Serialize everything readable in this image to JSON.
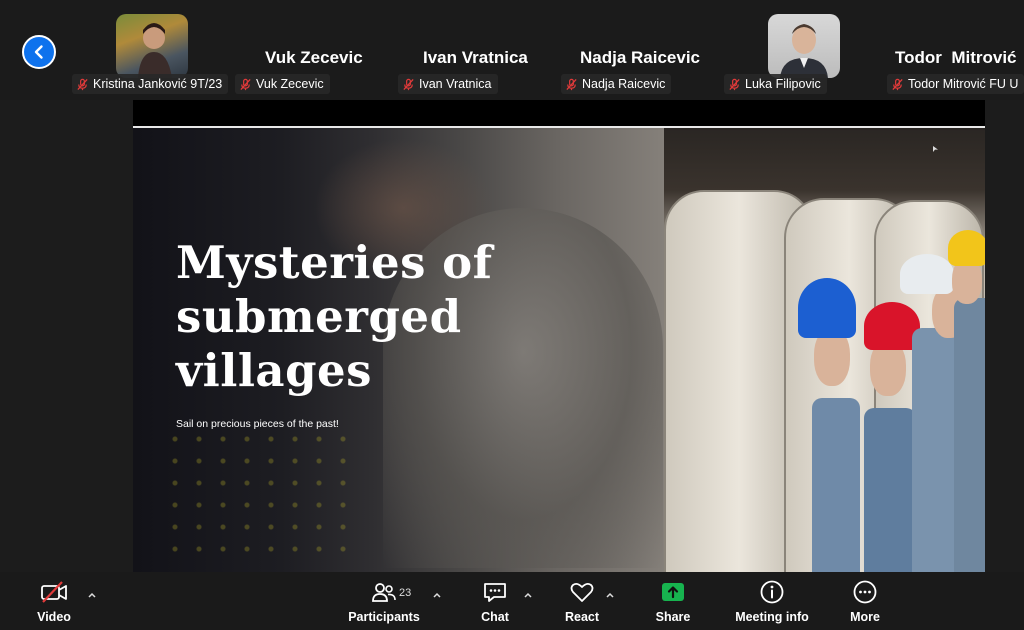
{
  "participants": [
    {
      "name": "Kristina Janković 9T/23",
      "has_video": true,
      "muted": true
    },
    {
      "name": "Vuk Zecevic",
      "has_video": false,
      "muted": true
    },
    {
      "name": "Ivan Vratnica",
      "has_video": false,
      "muted": true
    },
    {
      "name": "Nadja Raicevic",
      "has_video": false,
      "muted": true
    },
    {
      "name": "Luka Filipovic",
      "has_video": true,
      "muted": true
    },
    {
      "name": "Todor  Mitrović",
      "label": "Todor Mitrović FU U",
      "has_video": false,
      "muted": true
    }
  ],
  "slide": {
    "title": "Mysteries of submerged villages",
    "subtitle": "Sail on precious pieces of the past!"
  },
  "toolbar": {
    "video_label": "Video",
    "participants_label": "Participants",
    "participants_count": "23",
    "chat_label": "Chat",
    "react_label": "React",
    "share_label": "Share",
    "meeting_info_label": "Meeting info",
    "more_label": "More"
  },
  "colors": {
    "accent_blue": "#0e72ed",
    "share_green": "#17b34f",
    "muted_red": "#e03a3a",
    "toolbar_bg": "#1a1a1a"
  },
  "icons": [
    "chevron-left-icon",
    "mic-muted-icon",
    "video-off-icon",
    "participants-icon",
    "chat-icon",
    "heart-icon",
    "share-screen-icon",
    "info-icon",
    "more-icon",
    "caret-up-icon"
  ]
}
